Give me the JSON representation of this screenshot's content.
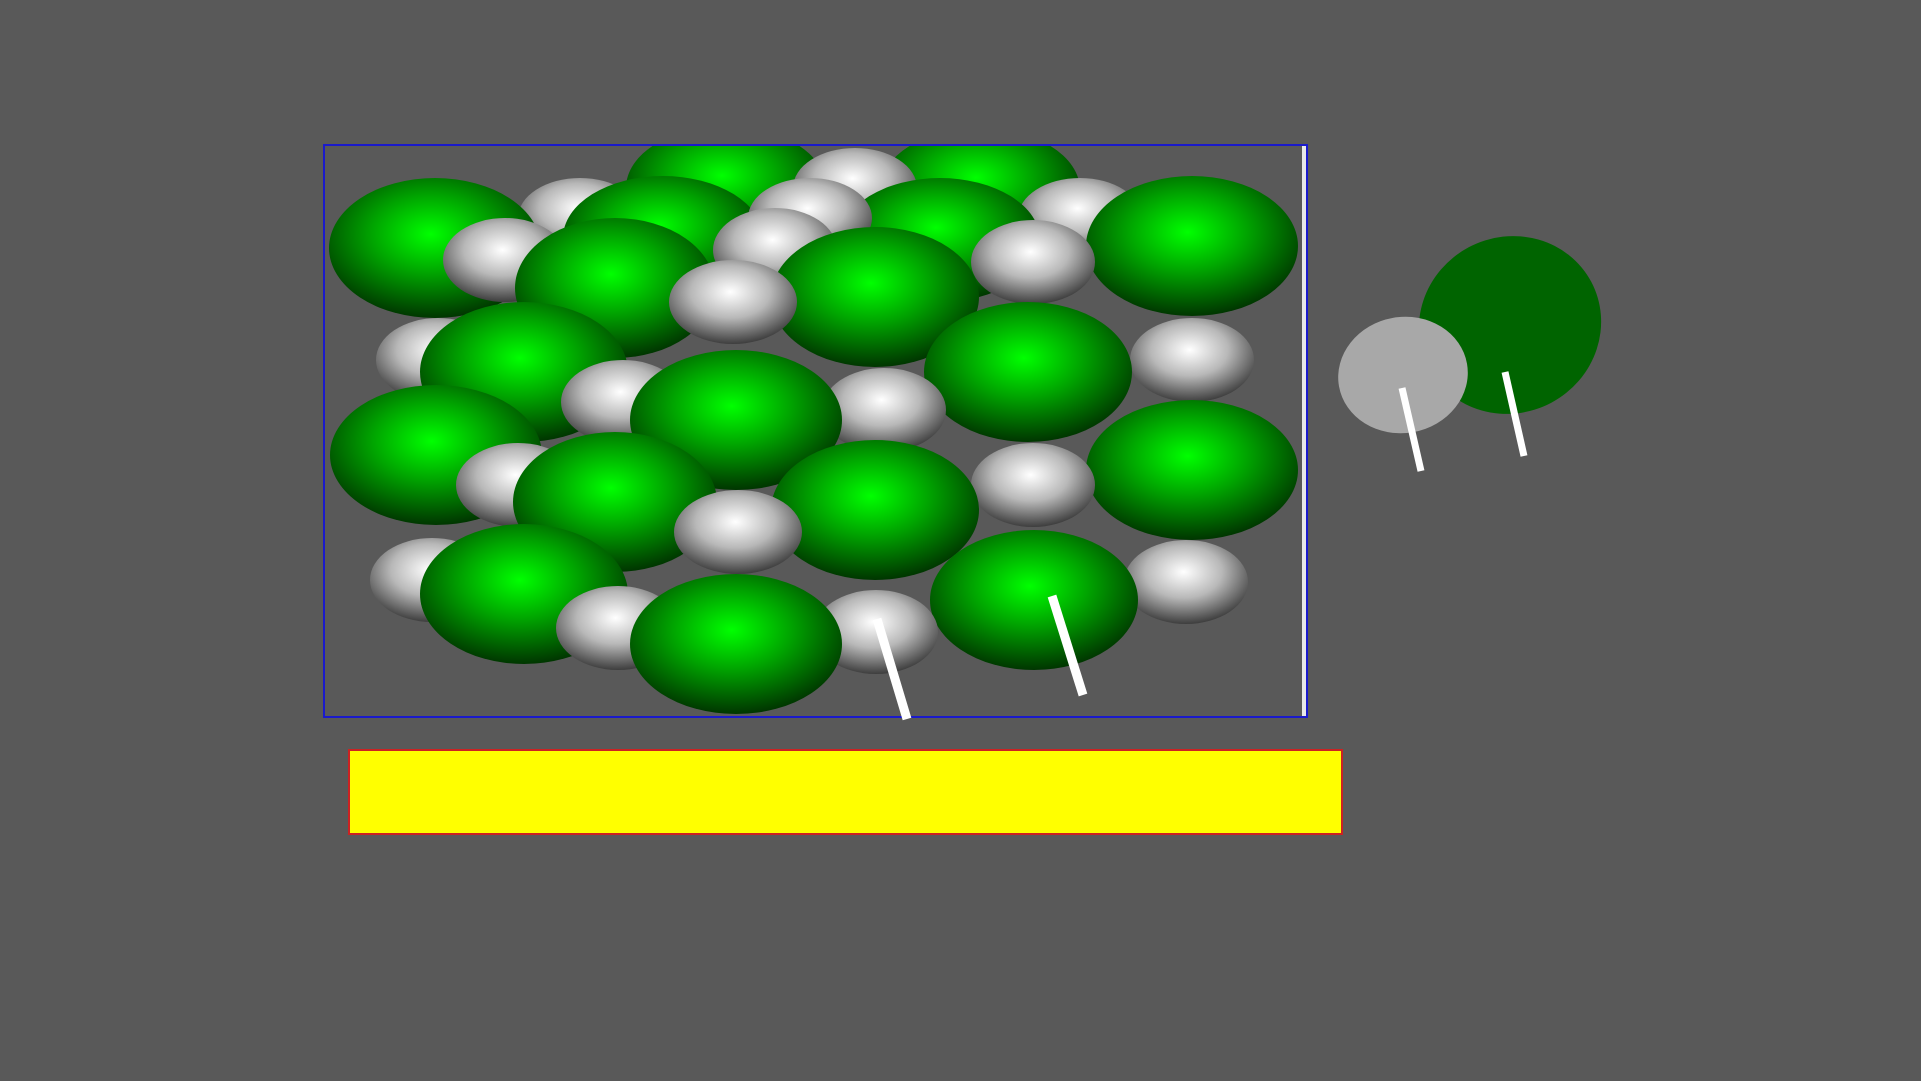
{
  "colors": {
    "background": "#595959",
    "frame_border": "#1a1acc",
    "answer_fill": "#ffff00",
    "answer_border": "#cc2222",
    "chloride_ion": "#00c800",
    "sodium_ion": "#d8d8d8",
    "legend_chloride": "#006400",
    "legend_sodium": "#a8a8a8",
    "pointer": "#ffffff"
  },
  "diagram": {
    "title": "",
    "lattice": {
      "label": ""
    },
    "legend": {
      "sodium_label": "",
      "chloride_label": ""
    },
    "answer_box": {
      "text": ""
    }
  }
}
